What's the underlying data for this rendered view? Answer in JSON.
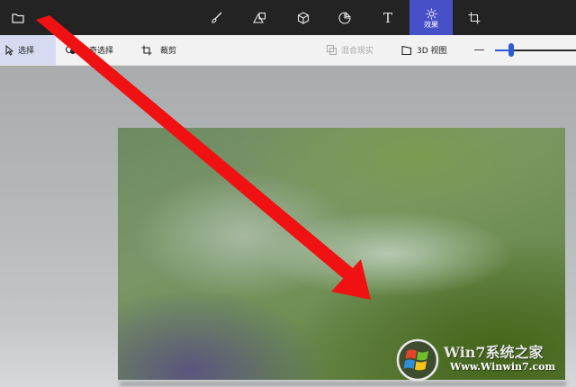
{
  "app": {
    "top_toolbar": {
      "items": [
        {
          "name": "menu-folder",
          "icon": "folder-icon"
        },
        {
          "name": "brushes",
          "icon": "brush-icon"
        },
        {
          "name": "2d-shapes",
          "icon": "shapes-icon"
        },
        {
          "name": "3d-shapes",
          "icon": "cube-icon"
        },
        {
          "name": "stickers",
          "icon": "sticker-icon"
        },
        {
          "name": "text",
          "icon": "text-icon",
          "glyph": "T"
        },
        {
          "name": "effects",
          "icon": "effects-icon",
          "label": "效果",
          "active": true
        },
        {
          "name": "canvas",
          "icon": "canvas-icon"
        }
      ],
      "active_color": "#4850c8"
    },
    "sub_toolbar": {
      "select_label": "选择",
      "magic_select_label": "神奇选择",
      "crop_label": "裁剪",
      "mixed_reality_label": "混合现实",
      "view_3d_label": "3D 视图",
      "zoom_slider_value": 0.2
    },
    "watermark": {
      "title": "Win7系统之家",
      "url": "Www.Winwin7.com"
    },
    "annotation": {
      "arrow_color": "#f01212"
    }
  }
}
